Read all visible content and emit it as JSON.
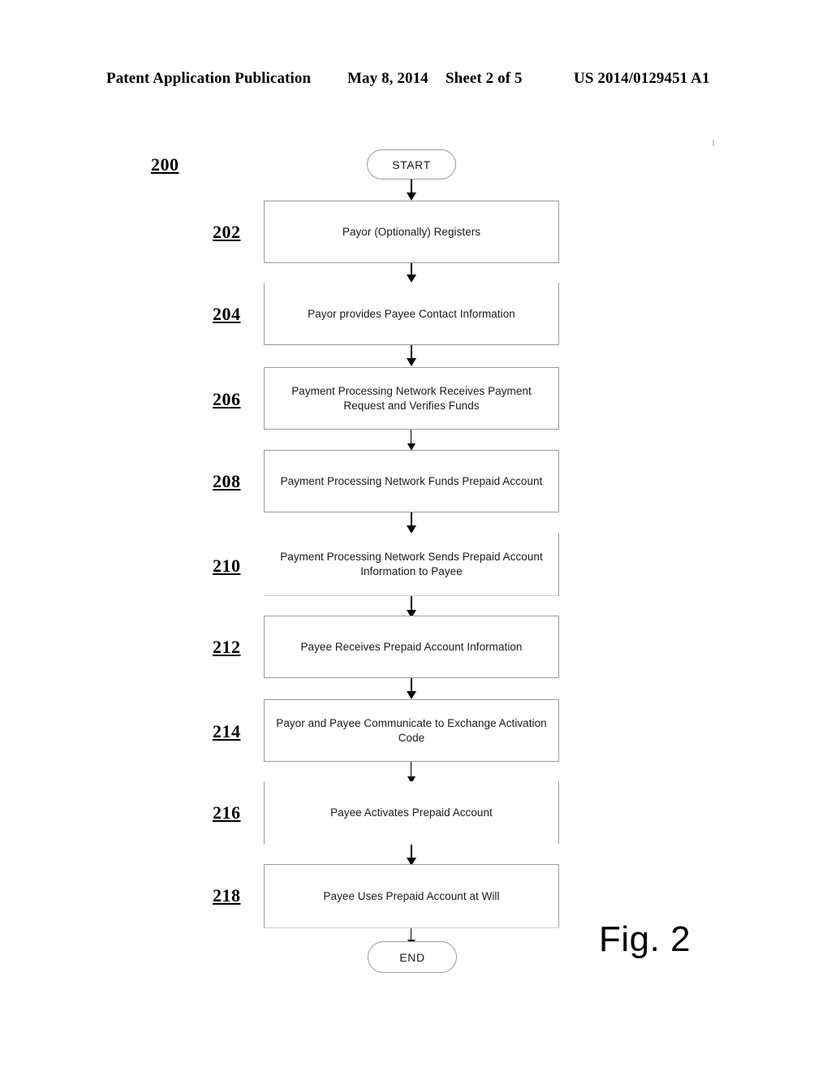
{
  "header": {
    "publication": "Patent Application Publication",
    "date": "May 8, 2014",
    "sheet": "Sheet 2 of 5",
    "patent_number": "US 2014/0129451 A1"
  },
  "figure": {
    "caption": "Fig. 2",
    "diagram_ref": "200"
  },
  "flowchart": {
    "start_label": "START",
    "end_label": "END",
    "steps": [
      {
        "ref": "202",
        "text": "Payor (Optionally) Registers"
      },
      {
        "ref": "204",
        "text": "Payor provides Payee Contact Information"
      },
      {
        "ref": "206",
        "text": "Payment Processing Network Receives Payment Request and Verifies Funds"
      },
      {
        "ref": "208",
        "text": "Payment Processing Network Funds Prepaid Account"
      },
      {
        "ref": "210",
        "text": "Payment Processing Network Sends Prepaid Account Information to Payee"
      },
      {
        "ref": "212",
        "text": "Payee Receives Prepaid Account Information"
      },
      {
        "ref": "214",
        "text": "Payor and Payee Communicate to Exchange Activation Code"
      },
      {
        "ref": "216",
        "text": "Payee Activates Prepaid Account"
      },
      {
        "ref": "218",
        "text": "Payee Uses Prepaid Account at Will"
      }
    ]
  },
  "colors": {
    "ink": "#000000",
    "box_border": "#9b9b9b",
    "page_background": "#ffffff"
  }
}
